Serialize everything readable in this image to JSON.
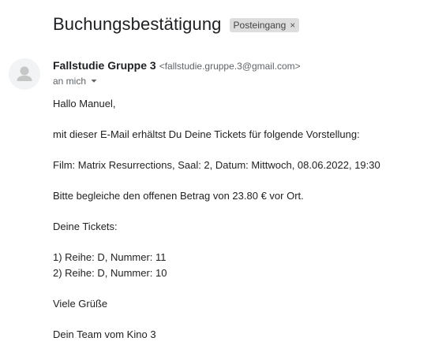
{
  "email": {
    "subject": "Buchungsbestätigung",
    "label": "Posteingang",
    "label_close": "×",
    "sender_name": "Fallstudie Gruppe 3",
    "sender_email": "<fallstudie.gruppe.3@gmail.com>",
    "recipient": "an mich",
    "body": {
      "greeting": "Hallo Manuel,",
      "intro": "mit dieser E-Mail erhältst Du Deine Tickets für folgende Vorstellung:",
      "film": "Film: Matrix Resurrections, Saal: 2, Datum: Mittwoch, 08.06.2022, 19:30",
      "payment": "Bitte begleiche den offenen Betrag von 23.80 € vor Ort.",
      "tickets_heading": "Deine Tickets:",
      "tickets": [
        "1) Reihe: D, Nummer: 11",
        "2) Reihe: D, Nummer: 10"
      ],
      "closing": "Viele Grüße",
      "signature": "Dein Team vom Kino 3"
    }
  },
  "icons": {
    "avatar": "person-icon",
    "recipient_toggle": "caret-down-icon"
  },
  "colors": {
    "chip_bg": "#dddddd",
    "avatar_bg": "#f1f3f4",
    "avatar_fg": "#c4c7c5",
    "secondary_text": "#5f6368"
  }
}
